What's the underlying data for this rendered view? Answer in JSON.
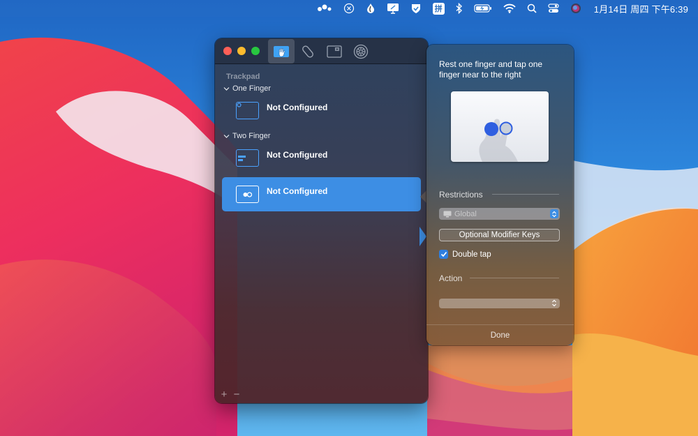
{
  "menubar": {
    "items": [
      {
        "name": "dots-icon"
      },
      {
        "name": "close-circle-icon"
      },
      {
        "name": "droplet-icon"
      },
      {
        "name": "screen-share-icon"
      },
      {
        "name": "shield-check-icon"
      },
      {
        "name": "pinyin-input-icon",
        "text": "拼"
      },
      {
        "name": "bluetooth-icon"
      },
      {
        "name": "battery-icon"
      },
      {
        "name": "wifi-icon"
      },
      {
        "name": "spotlight-search-icon"
      },
      {
        "name": "control-center-icon"
      },
      {
        "name": "siri-icon"
      }
    ],
    "clock": "1月14日 周四 下午6:39"
  },
  "window": {
    "tabs": [
      {
        "name": "trackpad-tab",
        "active": true
      },
      {
        "name": "magic-mouse-tab",
        "active": false
      },
      {
        "name": "window-snap-tab",
        "active": false
      },
      {
        "name": "preferences-tab",
        "active": false
      }
    ],
    "sidebar_title": "Trackpad",
    "groups": [
      {
        "header": "One Finger",
        "items": [
          {
            "label": "Not Configured",
            "selected": false
          }
        ]
      },
      {
        "header": "Two Finger",
        "items": [
          {
            "label": "Not Configured",
            "selected": false
          },
          {
            "label": "Not Configured",
            "selected": true
          }
        ]
      }
    ],
    "bottom_tools": {
      "add": "+",
      "remove": "−"
    }
  },
  "popover": {
    "description": "Rest one finger and tap one finger near to the right",
    "restrictions_label": "Restrictions",
    "scope_select": {
      "value": "Global"
    },
    "modifier_button": "Optional Modifier Keys",
    "double_tap": {
      "label": "Double tap",
      "checked": true
    },
    "action_label": "Action",
    "action_select": {
      "value": ""
    },
    "done_button": "Done"
  },
  "colors": {
    "accent": "#3d8ee4",
    "icon_blue": "#4ba2ff",
    "close": "#ff5f57",
    "minimize": "#febc2e",
    "zoom": "#28c840"
  }
}
